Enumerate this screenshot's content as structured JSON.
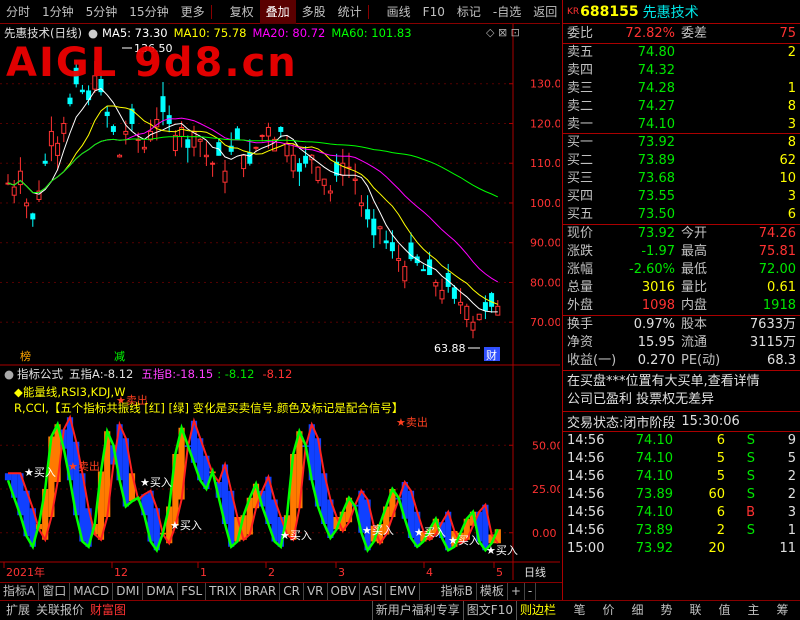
{
  "toolbar": {
    "items": [
      "分时",
      "1分钟",
      "5分钟",
      "15分钟",
      "更多",
      "复权",
      "叠加",
      "多股",
      "统计",
      "画线",
      "F10",
      "标记",
      "-自选",
      "返回"
    ],
    "active": "叠加"
  },
  "main_chart": {
    "title": "先惠技术(日线)",
    "ma": [
      {
        "label": "MA5: 73.30",
        "color": "#ffffff"
      },
      {
        "label": "MA10: 75.78",
        "color": "#ffff00"
      },
      {
        "label": "MA20: 80.72",
        "color": "#ff00ff"
      },
      {
        "label": "MA60: 101.83",
        "color": "#00ff00"
      }
    ],
    "watermark": "AIGL 9d8.cn",
    "high_label": "136.50",
    "low_label": "63.88",
    "y_ticks": [
      {
        "v": 130,
        "t": "130.0"
      },
      {
        "v": 120,
        "t": "120.0"
      },
      {
        "v": 110,
        "t": "110.0"
      },
      {
        "v": 100,
        "t": "100.0"
      },
      {
        "v": 90,
        "t": "90.00"
      },
      {
        "v": 80,
        "t": "80.00"
      },
      {
        "v": 70,
        "t": "70.00"
      }
    ],
    "marker_left": "榜",
    "marker_mid": "减",
    "marker_right": "财"
  },
  "indicator": {
    "name": "指标公式",
    "zhibiao_a_label": "五指A:",
    "zhibiao_a": "-8.12",
    "zhibiao_b_label": "五指B:",
    "zhibiao_b": "-18.15",
    "v3": ": -8.12",
    "v4": "-8.12",
    "desc1": "◆能量线,RSI3,KDJ,W",
    "desc2": "R,CCI,【五个指标共振线 [红] [绿] 变化是买卖信号.颜色及标记是配合信号】",
    "y_ticks": [
      {
        "v": 50,
        "t": "50.00"
      },
      {
        "v": 25,
        "t": "25.00"
      },
      {
        "v": 0,
        "t": "0.00"
      }
    ],
    "buy": "★买入",
    "sell": "★卖出"
  },
  "xaxis": {
    "labels": [
      "2021年",
      "12",
      "1",
      "2",
      "3",
      "4",
      "5"
    ],
    "period": "日线"
  },
  "bottom_tabs": [
    "指标A",
    "窗口",
    "MACD",
    "DMI",
    "DMA",
    "FSL",
    "TRIX",
    "BRAR",
    "CR",
    "VR",
    "OBV",
    "ASI",
    "EMV",
    "指标B",
    "模板",
    "+",
    "-"
  ],
  "status": {
    "left": [
      "扩展",
      "关联报价",
      "财富图"
    ],
    "mid": [
      "新用户福利专享",
      "图文F10",
      "则边栏"
    ],
    "right": [
      "笔",
      "价",
      "细",
      "势",
      "联",
      "值",
      "主",
      "筹"
    ]
  },
  "quote": {
    "badge": "KR",
    "code": "688155",
    "name": "先惠技术",
    "weibi_label": "委比",
    "weibi": "72.82%",
    "weicha_label": "委差",
    "weicha": "75",
    "sell": [
      {
        "l": "卖五",
        "p": "74.80",
        "v": "2"
      },
      {
        "l": "卖四",
        "p": "74.32",
        "v": ""
      },
      {
        "l": "卖三",
        "p": "74.28",
        "v": "1"
      },
      {
        "l": "卖二",
        "p": "74.27",
        "v": "8"
      },
      {
        "l": "卖一",
        "p": "74.10",
        "v": "3"
      }
    ],
    "buy": [
      {
        "l": "买一",
        "p": "73.92",
        "v": "8"
      },
      {
        "l": "买二",
        "p": "73.89",
        "v": "62"
      },
      {
        "l": "买三",
        "p": "73.68",
        "v": "10"
      },
      {
        "l": "买四",
        "p": "73.55",
        "v": "3"
      },
      {
        "l": "买五",
        "p": "73.50",
        "v": "6"
      }
    ],
    "stats": [
      {
        "l": "现价",
        "v": "73.92",
        "vc": "grn",
        "l2": "今开",
        "v2": "74.26",
        "v2c": "red"
      },
      {
        "l": "涨跌",
        "v": "-1.97",
        "vc": "grn",
        "l2": "最高",
        "v2": "75.81",
        "v2c": "red"
      },
      {
        "l": "涨幅",
        "v": "-2.60%",
        "vc": "grn",
        "l2": "最低",
        "v2": "72.00",
        "v2c": "grn"
      },
      {
        "l": "总量",
        "v": "3016",
        "vc": "yel",
        "l2": "量比",
        "v2": "0.61",
        "v2c": "yel"
      },
      {
        "l": "外盘",
        "v": "1098",
        "vc": "red",
        "l2": "内盘",
        "v2": "1918",
        "v2c": "grn"
      }
    ],
    "stats2": [
      {
        "l": "换手",
        "v": "0.97%",
        "l2": "股本",
        "v2": "7633万"
      },
      {
        "l": "净资",
        "v": "15.95",
        "l2": "流通",
        "v2": "3115万"
      },
      {
        "l": "收益(一)",
        "v": "0.270",
        "l2": "PE(动)",
        "v2": "68.3"
      }
    ],
    "news1": "在买盘***位置有大买单,查看详情",
    "news2": "公司已盈利 投票权无差异",
    "trade_status_label": "交易状态:",
    "trade_status": "闭市阶段",
    "trade_time": "15:30:06",
    "ticks": [
      {
        "t": "14:56",
        "p": "74.10",
        "v": "6",
        "d": "S",
        "n": "9"
      },
      {
        "t": "14:56",
        "p": "74.10",
        "v": "5",
        "d": "S",
        "n": "5"
      },
      {
        "t": "14:56",
        "p": "74.10",
        "v": "5",
        "d": "S",
        "n": "2"
      },
      {
        "t": "14:56",
        "p": "73.89",
        "v": "60",
        "d": "S",
        "n": "2"
      },
      {
        "t": "14:56",
        "p": "74.10",
        "v": "6",
        "d": "B",
        "n": "3"
      },
      {
        "t": "14:56",
        "p": "73.89",
        "v": "2",
        "d": "S",
        "n": "1"
      },
      {
        "t": "15:00",
        "p": "73.92",
        "v": "20",
        "d": "",
        "n": "11"
      }
    ]
  }
}
